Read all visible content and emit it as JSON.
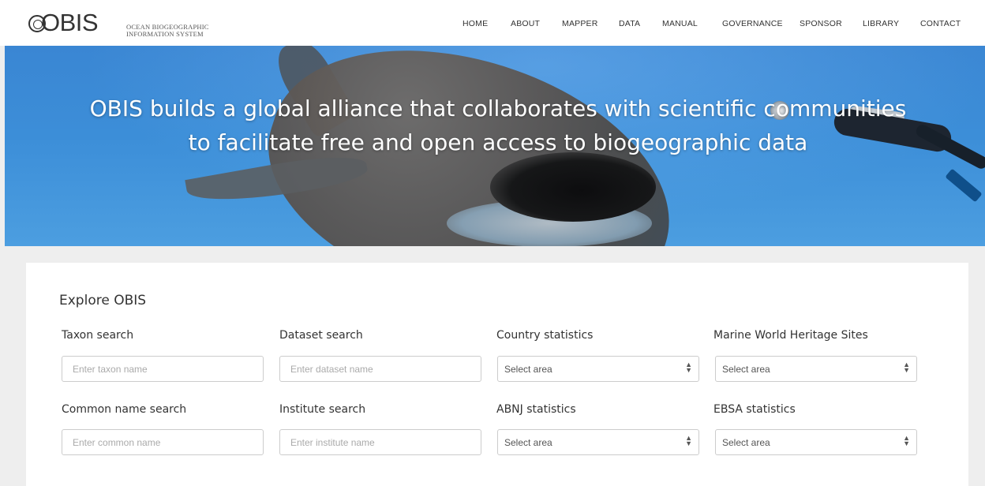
{
  "header": {
    "logo_text": "OBIS",
    "logo_subtitle_line1": "OCEAN BIOGEOGRAPHIC",
    "logo_subtitle_line2": "INFORMATION SYSTEM",
    "nav": [
      "HOME",
      "ABOUT",
      "MAPPER",
      "DATA",
      "MANUAL",
      "GOVERNANCE",
      "SPONSOR",
      "LIBRARY",
      "CONTACT"
    ]
  },
  "hero": {
    "headline": "OBIS builds a global alliance that collaborates with scientific communities to facilitate free and open access to biogeographic data"
  },
  "explore": {
    "title": "Explore OBIS",
    "taxon": {
      "label": "Taxon search",
      "placeholder": "Enter taxon name"
    },
    "dataset": {
      "label": "Dataset search",
      "placeholder": "Enter dataset name"
    },
    "country": {
      "label": "Country statistics",
      "selected": "Select area"
    },
    "heritage": {
      "label": "Marine World Heritage Sites",
      "selected": "Select area"
    },
    "common": {
      "label": "Common name search",
      "placeholder": "Enter common name"
    },
    "institute": {
      "label": "Institute search",
      "placeholder": "Enter institute name"
    },
    "abnj": {
      "label": "ABNJ statistics",
      "selected": "Select area"
    },
    "ebsa": {
      "label": "EBSA statistics",
      "selected": "Select area"
    }
  }
}
